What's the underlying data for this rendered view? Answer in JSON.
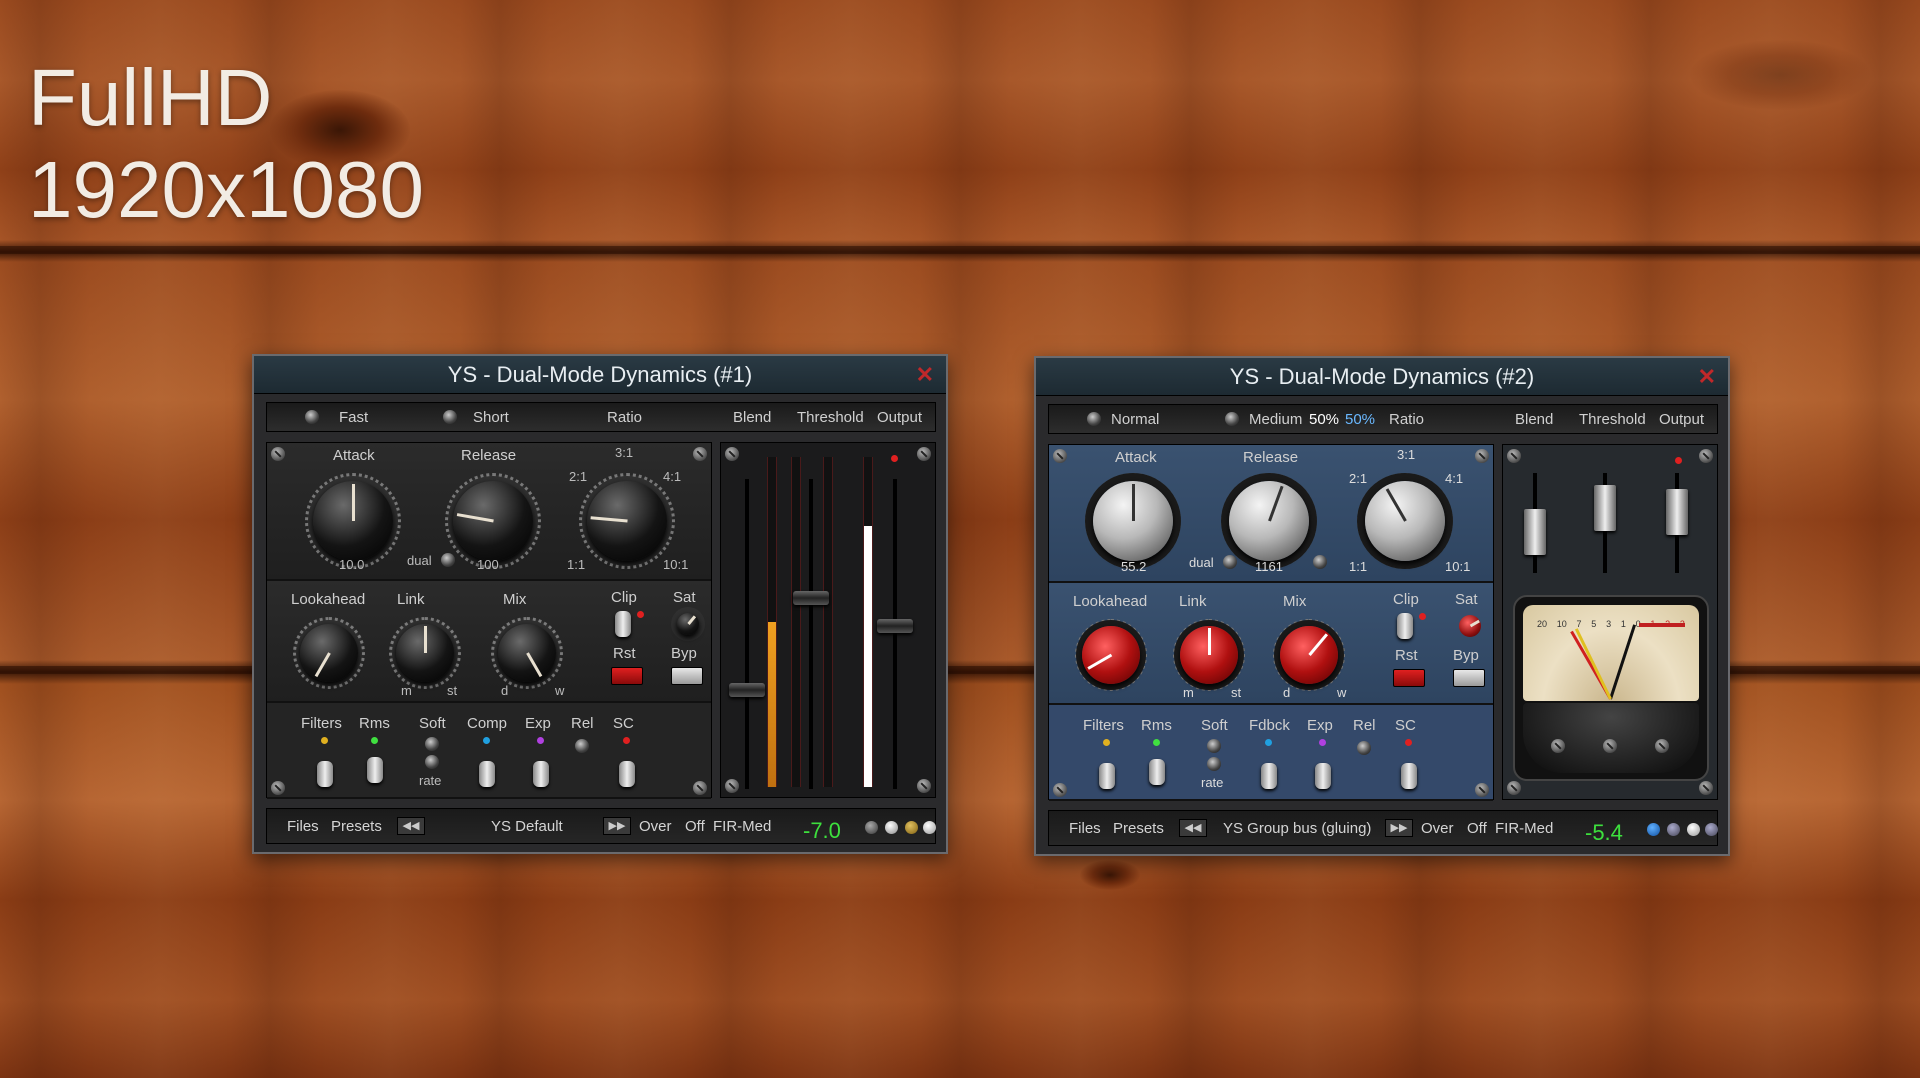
{
  "overlay": {
    "line1": "FullHD",
    "line2": "1920x1080"
  },
  "plugins": [
    {
      "title": "YS - Dual-Mode Dynamics (#1)",
      "close_icon": "close-icon",
      "top": {
        "attack_mode": "Fast",
        "release_mode": "Short",
        "ratio": "Ratio",
        "blend": "Blend",
        "threshold": "Threshold",
        "output": "Output"
      },
      "knobs": {
        "attack": "Attack",
        "attack_value": "10.0",
        "release": "Release",
        "release_value": "100",
        "dual": "dual",
        "ratio_top": "3:1",
        "ratio_left": "2:1",
        "ratio_right": "4:1",
        "ratio_bl": "1:1",
        "ratio_br": "10:1"
      },
      "row2": {
        "lookahead": "Lookahead",
        "link": "Link",
        "mix": "Mix",
        "clip": "Clip",
        "sat": "Sat",
        "rst": "Rst",
        "byp": "Byp",
        "m": "m",
        "st": "st",
        "d": "d",
        "w": "w"
      },
      "row3": {
        "filters": "Filters",
        "rms": "Rms",
        "soft": "Soft",
        "comp": "Comp",
        "exp": "Exp",
        "rel": "Rel",
        "sc": "SC",
        "rate": "rate"
      },
      "bottom": {
        "files": "Files",
        "presets": "Presets",
        "preset_name": "YS Default",
        "over": "Over",
        "off": "Off",
        "fir": "FIR-Med",
        "readout": "-7.0"
      },
      "levels": {
        "meter1": 0.5,
        "meter2": 0.79
      },
      "colors": {
        "panel": "#1f1f1f",
        "meter_amber": "#f0a020",
        "meter_white": "#ffffff",
        "readout": "#3de03d"
      }
    },
    {
      "title": "YS - Dual-Mode Dynamics (#2)",
      "close_icon": "close-icon",
      "top": {
        "attack_mode": "Normal",
        "release_mode": "Medium",
        "pct1": "50%",
        "pct2": "50%",
        "ratio": "Ratio",
        "blend": "Blend",
        "threshold": "Threshold",
        "output": "Output"
      },
      "knobs": {
        "attack": "Attack",
        "attack_value": "55.2",
        "release": "Release",
        "release_value": "1161",
        "dual": "dual",
        "ratio_top": "3:1",
        "ratio_left": "2:1",
        "ratio_right": "4:1",
        "ratio_bl": "1:1",
        "ratio_br": "10:1"
      },
      "row2": {
        "lookahead": "Lookahead",
        "link": "Link",
        "mix": "Mix",
        "clip": "Clip",
        "sat": "Sat",
        "rst": "Rst",
        "byp": "Byp",
        "m": "m",
        "st": "st",
        "d": "d",
        "w": "w"
      },
      "row3": {
        "filters": "Filters",
        "rms": "Rms",
        "soft": "Soft",
        "fdbck": "Fdbck",
        "exp": "Exp",
        "rel": "Rel",
        "sc": "SC",
        "rate": "rate"
      },
      "vu_scale": [
        "20",
        "10",
        "7",
        "5",
        "3",
        "1",
        "0",
        "1",
        "2",
        "3"
      ],
      "bottom": {
        "files": "Files",
        "presets": "Presets",
        "preset_name": "YS Group bus (gluing)",
        "over": "Over",
        "off": "Off",
        "fir": "FIR-Med",
        "readout": "-5.4"
      },
      "colors": {
        "panel": "#2e4460",
        "knob_red": "#b01010",
        "readout": "#3de03d"
      }
    }
  ],
  "transport": {
    "prev": "◀◀",
    "next": "▶▶"
  }
}
